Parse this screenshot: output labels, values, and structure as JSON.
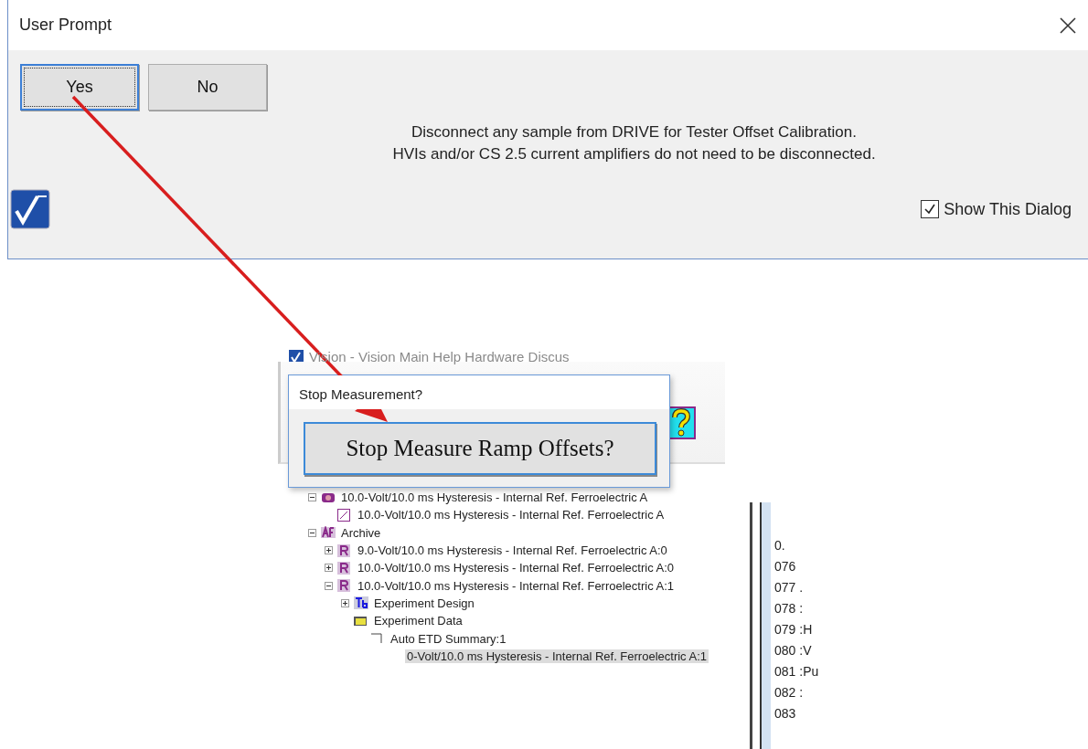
{
  "dialog": {
    "title": "User Prompt",
    "buttons": [
      {
        "label": "Yes",
        "focused": true
      },
      {
        "label": "No",
        "focused": false
      }
    ],
    "message": [
      "Disconnect any sample from DRIVE for Tester Offset Calibration.",
      "HVIs and/or CS 2.5 current amplifiers do not need to be disconnected."
    ],
    "checkbox": {
      "label": "Show This Dialog",
      "checked": true
    }
  },
  "background_window": {
    "title": "Vision - Vision Main Help Hardware Discus"
  },
  "stop_dialog": {
    "title": "Stop Measurement?",
    "button": "Stop Measure Ramp Offsets?"
  },
  "tree": [
    {
      "label": "10.0-Volt/10.0 ms Hysteresis - Internal Ref. Ferroelectric A",
      "kind": "group",
      "expanded": true,
      "selected": false,
      "children": [
        {
          "label": "10.0-Volt/10.0 ms Hysteresis - Internal Ref. Ferroelectric A",
          "kind": "chart",
          "selected": false
        }
      ]
    },
    {
      "label": "Archive",
      "kind": "archive",
      "expanded": true,
      "selected": false,
      "children": [
        {
          "label": "9.0-Volt/10.0 ms Hysteresis - Internal Ref. Ferroelectric A:0",
          "kind": "record",
          "expanded": false,
          "selected": false
        },
        {
          "label": "10.0-Volt/10.0 ms Hysteresis - Internal Ref. Ferroelectric A:0",
          "kind": "record",
          "expanded": false,
          "selected": false
        },
        {
          "label": "10.0-Volt/10.0 ms Hysteresis - Internal Ref. Ferroelectric A:1",
          "kind": "record",
          "expanded": true,
          "selected": false,
          "children": [
            {
              "label": "Experiment Design",
              "kind": "design",
              "expanded": false,
              "selected": false
            },
            {
              "label": "Experiment Data",
              "kind": "folder",
              "selected": false,
              "children": [
                {
                  "label": "Auto ETD Summary:1",
                  "kind": "summary",
                  "selected": false,
                  "children": [
                    {
                      "label": "0-Volt/10.0 ms Hysteresis - Internal Ref. Ferroelectric A:1",
                      "selected": true
                    }
                  ]
                }
              ]
            }
          ]
        }
      ]
    }
  ],
  "side_panel": {
    "lines": [
      "0.",
      "076",
      "077 .",
      "078 :",
      "079 :H",
      "080 :V",
      "081 :Pu",
      "082 :",
      "083"
    ]
  }
}
